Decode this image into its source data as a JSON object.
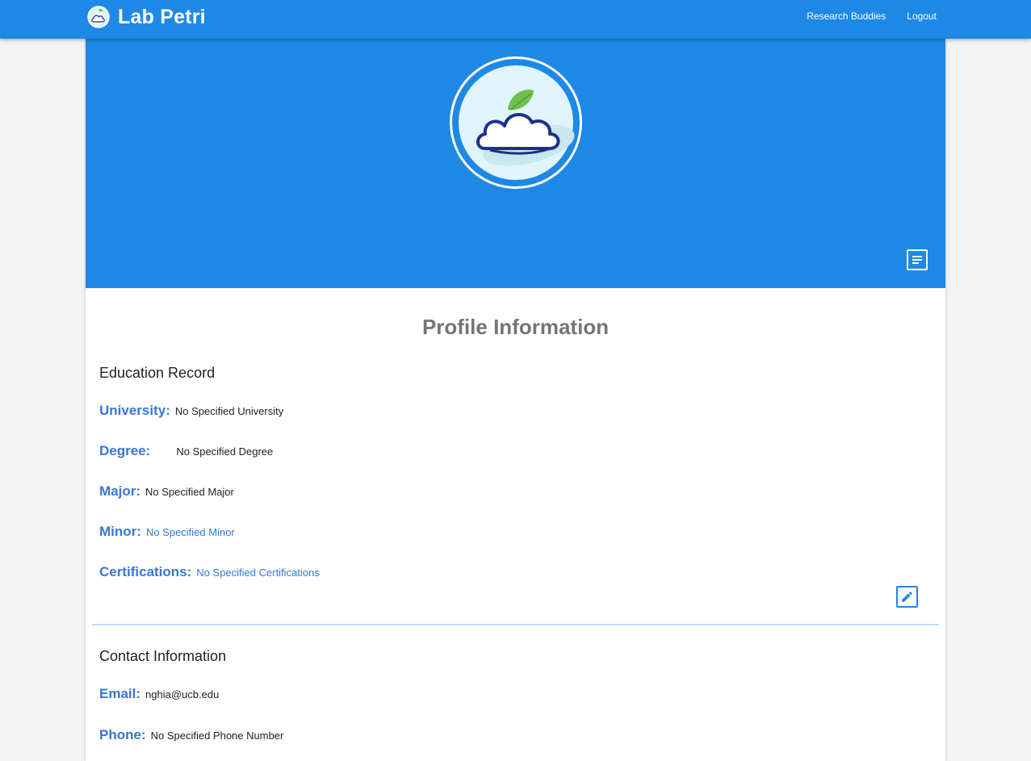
{
  "app": {
    "name": "Lab Petri"
  },
  "nav": {
    "links": [
      "Research Buddies",
      "Logout"
    ]
  },
  "profile": {
    "title": "Profile Information",
    "education": {
      "heading": "Education Record",
      "fields": [
        {
          "label": "University:",
          "value": "No Specified University"
        },
        {
          "label": "Degree:",
          "value": "No Specified Degree"
        },
        {
          "label": "Major:",
          "value": "No Specified Major"
        },
        {
          "label": "Minor:",
          "value": "No Specified Minor"
        },
        {
          "label": "Certifications:",
          "value": "No Specified Certifications"
        }
      ]
    },
    "contact": {
      "heading": "Contact Information",
      "fields": [
        {
          "label": "Email:",
          "value": "nghia@ucb.edu"
        },
        {
          "label": "Phone:",
          "value": "No Specified Phone Number"
        }
      ]
    }
  },
  "icons": {
    "logo": "cloud-leaf-logo-icon",
    "notes": "notes-icon",
    "edit": "pencil-icon"
  },
  "colors": {
    "primary": "#1e88e5",
    "label": "#3777d2",
    "divider": "#bbdefb",
    "title": "#757575"
  }
}
